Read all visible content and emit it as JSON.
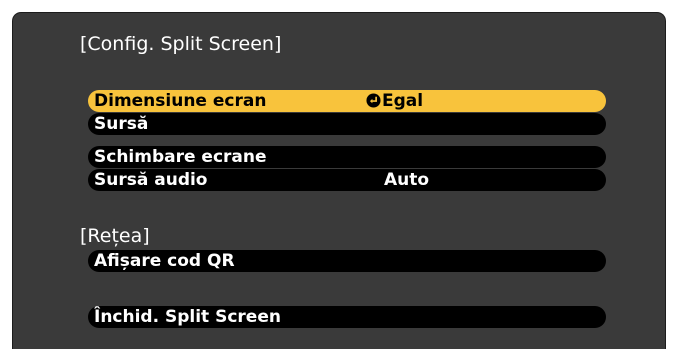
{
  "config_section": {
    "title": "[Config. Split Screen]",
    "items": [
      {
        "label": "Dimensiune ecran",
        "value": "Egal"
      },
      {
        "label": "Sursă",
        "value": ""
      },
      {
        "label": "Schimbare ecrane",
        "value": ""
      },
      {
        "label": "Sursă audio",
        "value": "Auto"
      }
    ]
  },
  "network_section": {
    "title": "[Rețea]",
    "items": [
      {
        "label": "Afișare cod QR"
      }
    ]
  },
  "exit_item": {
    "label": "Închid. Split Screen"
  },
  "selected_item": "Dimensiune ecran",
  "icons": {
    "enter": "enter-return-icon"
  },
  "colors": {
    "panel_background": "#3a3a3a",
    "item_background": "#000000",
    "selected_highlight": "#f8c33c",
    "text": "#ffffff",
    "selected_text": "#000000"
  }
}
